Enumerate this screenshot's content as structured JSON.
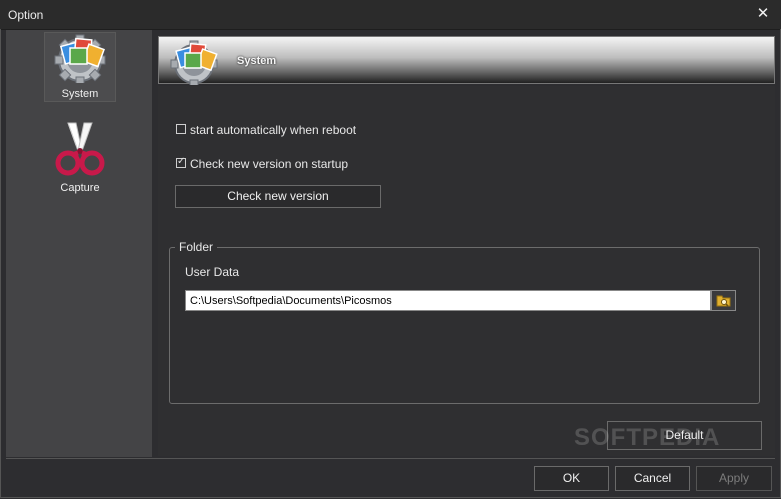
{
  "window": {
    "title": "Option"
  },
  "sidebar": {
    "items": [
      {
        "label": "System",
        "icon": "gear-photos-icon",
        "active": true
      },
      {
        "label": "Capture",
        "icon": "scissors-icon",
        "active": false
      }
    ]
  },
  "banner": {
    "title": "System"
  },
  "system": {
    "auto_start": {
      "label": "start automatically when reboot",
      "checked": false
    },
    "check_version_startup": {
      "label": "Check new version on startup",
      "checked": true
    },
    "check_button": "Check new version"
  },
  "folder": {
    "legend": "Folder",
    "user_data_label": "User Data",
    "user_data_path": "C:\\Users\\Softpedia\\Documents\\Picosmos"
  },
  "buttons": {
    "default": "Default",
    "ok": "OK",
    "cancel": "Cancel",
    "apply": "Apply"
  },
  "watermark": "SOFTPEDIA",
  "colors": {
    "accent_folder": "#e0b030",
    "background": "#2d2d30",
    "sidebar": "#444446"
  }
}
